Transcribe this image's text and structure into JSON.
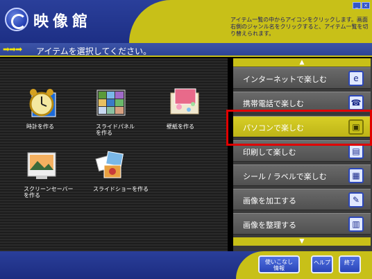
{
  "app": {
    "title": "映像館",
    "help_text": "アイテム一覧の中からアイコンをクリックします。画面右側のジャンル名をクリックすると、アイテム一覧を切り替えられます。"
  },
  "instruction": {
    "arrows": "➡➡➡",
    "text": "アイテムを選択してください。"
  },
  "items": [
    {
      "label": "時計を作る",
      "icon": "clock-icon"
    },
    {
      "label": "スライドパネル\nを作る",
      "icon": "slide-panel-icon"
    },
    {
      "label": "壁紙を作る",
      "icon": "wallpaper-icon"
    },
    {
      "label": "スクリーンセーバー\nを作る",
      "icon": "screensaver-icon"
    },
    {
      "label": "スライドショーを作る",
      "icon": "slideshow-icon"
    }
  ],
  "categories": [
    {
      "label": "インターネットで楽しむ",
      "icon": "internet-icon",
      "glyph": "e"
    },
    {
      "label": "携帯電話で楽しむ",
      "icon": "mobile-phone-icon",
      "glyph": "☎"
    },
    {
      "label": "パソコンで楽しむ",
      "icon": "pc-icon",
      "glyph": "▣",
      "selected": true
    },
    {
      "label": "印刷して楽しむ",
      "icon": "printer-icon",
      "glyph": "▤"
    },
    {
      "label": "シール / ラベルで楽しむ",
      "icon": "label-icon",
      "glyph": "▦"
    },
    {
      "label": "画像を加工する",
      "icon": "image-edit-icon",
      "glyph": "✎"
    },
    {
      "label": "画像を整理する",
      "icon": "image-organize-icon",
      "glyph": "▥"
    }
  ],
  "scroll": {
    "up": "▲",
    "down": "▼"
  },
  "footer": {
    "tips_label": "使いこなし\n情報",
    "help_label": "ヘルプ",
    "exit_label": "終了"
  },
  "window": {
    "minimize": "_",
    "close": "×"
  },
  "colors": {
    "accent_yellow": "#c8c018",
    "header_blue": "#2a3f9a",
    "selection_border": "#e00000"
  }
}
